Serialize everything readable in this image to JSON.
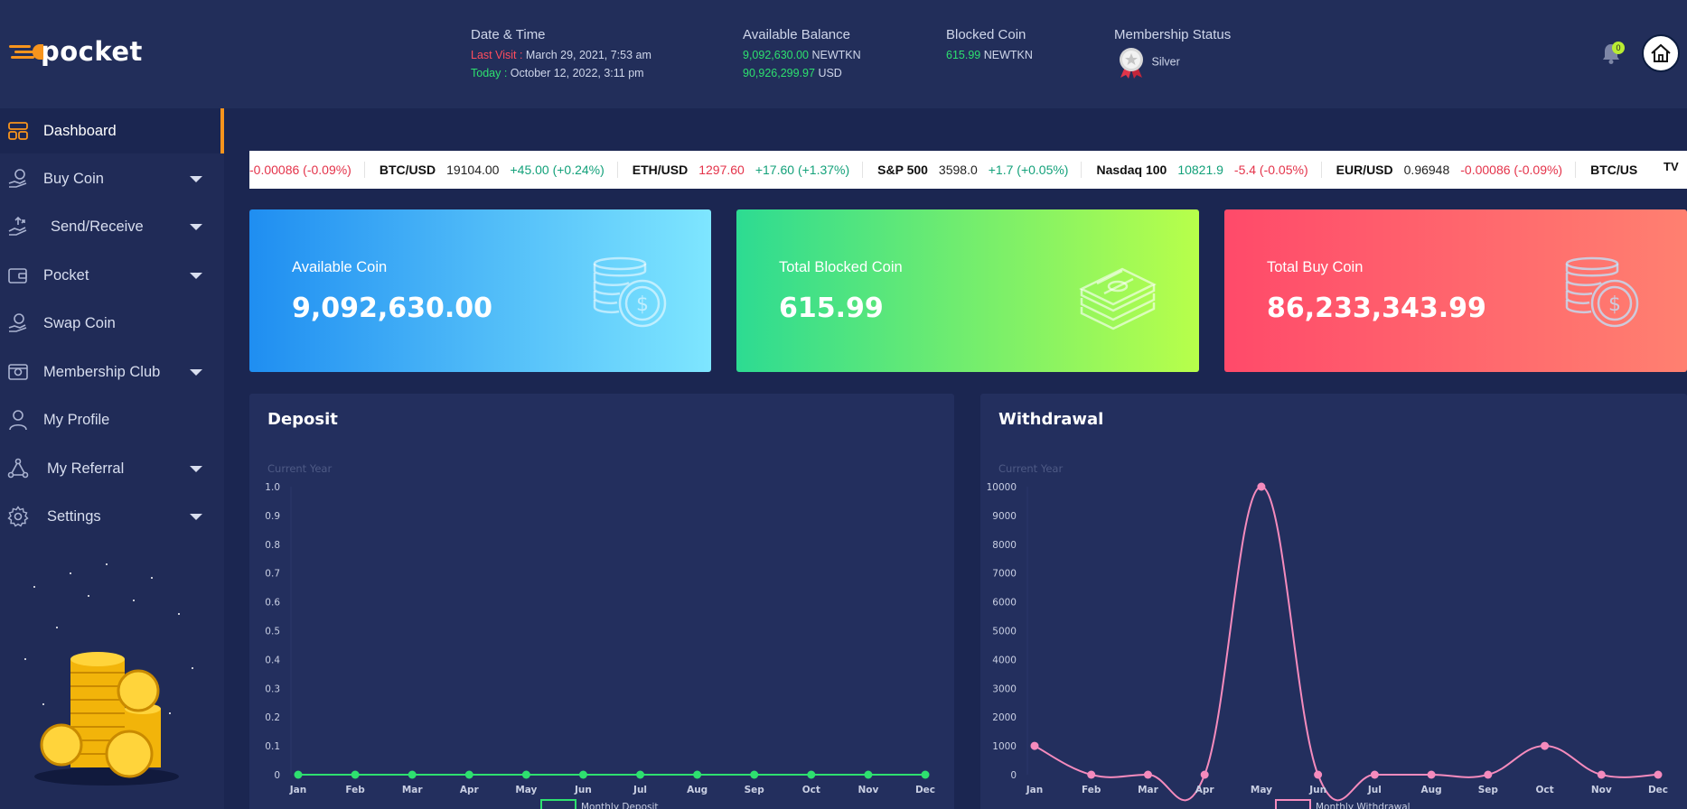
{
  "brand": {
    "name": "pocket"
  },
  "header": {
    "date_time": {
      "title": "Date & Time",
      "last_visit_label": "Last Visit :",
      "last_visit_value": "March 29, 2021, 7:53 am",
      "today_label": "Today :",
      "today_value": "October 12, 2022, 3:11 pm"
    },
    "available_balance": {
      "title": "Available Balance",
      "line1_amount": "9,092,630.00",
      "line1_unit": "NEWTKN",
      "line2_amount": "90,926,299.97",
      "line2_unit": "USD"
    },
    "blocked_coin": {
      "title": "Blocked Coin",
      "amount": "615.99",
      "unit": "NEWTKN"
    },
    "membership": {
      "title": "Membership Status",
      "level": "Silver"
    },
    "notifications": {
      "count": "0"
    }
  },
  "sidebar": {
    "items": [
      {
        "label": "Dashboard",
        "icon": "dashboard-icon",
        "active": true,
        "has_submenu": false
      },
      {
        "label": "Buy Coin",
        "icon": "hand-coin-icon",
        "has_submenu": true
      },
      {
        "label": "Send/Receive",
        "icon": "hand-send-icon",
        "has_submenu": true
      },
      {
        "label": "Pocket",
        "icon": "wallet-icon",
        "has_submenu": true
      },
      {
        "label": "Swap Coin",
        "icon": "swap-hand-icon",
        "has_submenu": false
      },
      {
        "label": "Membership Club",
        "icon": "membership-card-icon",
        "has_submenu": true
      },
      {
        "label": "My Profile",
        "icon": "user-icon",
        "has_submenu": false
      },
      {
        "label": "My Referral",
        "icon": "share-nodes-icon",
        "has_submenu": true
      },
      {
        "label": "Settings",
        "icon": "gear-icon",
        "has_submenu": true
      }
    ]
  },
  "ticker": {
    "lead_change": "-0.00086 (-0.09%)",
    "items": [
      {
        "symbol": "BTC/USD",
        "price": "19104.00",
        "change": "+45.00 (+0.24%)",
        "dir": "up"
      },
      {
        "symbol": "ETH/USD",
        "price": "1297.60",
        "change": "+17.60 (+1.37%)",
        "dir": "up",
        "price_dir": "dn"
      },
      {
        "symbol": "S&P 500",
        "price": "3598.0",
        "change": "+1.7 (+0.05%)",
        "dir": "up"
      },
      {
        "symbol": "Nasdaq 100",
        "price": "10821.9",
        "change": "-5.4 (-0.05%)",
        "dir": "dn",
        "price_dir": "up"
      },
      {
        "symbol": "EUR/USD",
        "price": "0.96948",
        "change": "-0.00086 (-0.09%)",
        "dir": "dn"
      },
      {
        "symbol": "BTC/US",
        "price": "",
        "change": "",
        "dir": "up"
      }
    ]
  },
  "cards": [
    {
      "label": "Available Coin",
      "value": "9,092,630.00",
      "icon": "coin-stack-icon",
      "gradient": [
        "#1f8ef1",
        "#7ee6ff"
      ]
    },
    {
      "label": "Total Blocked Coin",
      "value": "615.99",
      "icon": "cash-stack-icon",
      "gradient": [
        "#2ddb92",
        "#b8ff4a"
      ]
    },
    {
      "label": "Total Buy Coin",
      "value": "86,233,343.99",
      "icon": "coin-stack-icon",
      "gradient": [
        "#ff4a6a",
        "#ff8070"
      ]
    }
  ],
  "chart_data": [
    {
      "type": "line",
      "title": "Deposit",
      "subtitle": "Current Year",
      "categories": [
        "Jan",
        "Feb",
        "Mar",
        "Apr",
        "May",
        "Jun",
        "Jul",
        "Aug",
        "Sep",
        "Oct",
        "Nov",
        "Dec"
      ],
      "series": [
        {
          "name": "Monthly Deposit",
          "values": [
            0,
            0,
            0,
            0,
            0,
            0,
            0,
            0,
            0,
            0,
            0,
            0
          ],
          "color": "#2ee06f"
        }
      ],
      "ylim": [
        0,
        1.0
      ],
      "yticks": [
        "1.0",
        "0.9",
        "0.8",
        "0.7",
        "0.6",
        "0.5",
        "0.4",
        "0.3",
        "0.2",
        "0.1",
        "0"
      ],
      "legend": "bottom"
    },
    {
      "type": "line",
      "title": "Withdrawal",
      "subtitle": "Current Year",
      "categories": [
        "Jan",
        "Feb",
        "Mar",
        "Apr",
        "May",
        "Jun",
        "Jul",
        "Aug",
        "Sep",
        "Oct",
        "Nov",
        "Dec"
      ],
      "series": [
        {
          "name": "Monthly Withdrawal",
          "values": [
            1000,
            0,
            0,
            0,
            10000,
            0,
            0,
            0,
            0,
            1000,
            0,
            0
          ],
          "color": "#f58bbd"
        }
      ],
      "ylim": [
        0,
        10000
      ],
      "yticks": [
        "10000",
        "9000",
        "8000",
        "7000",
        "6000",
        "5000",
        "4000",
        "3000",
        "2000",
        "1000",
        "0"
      ],
      "legend": "bottom"
    }
  ]
}
